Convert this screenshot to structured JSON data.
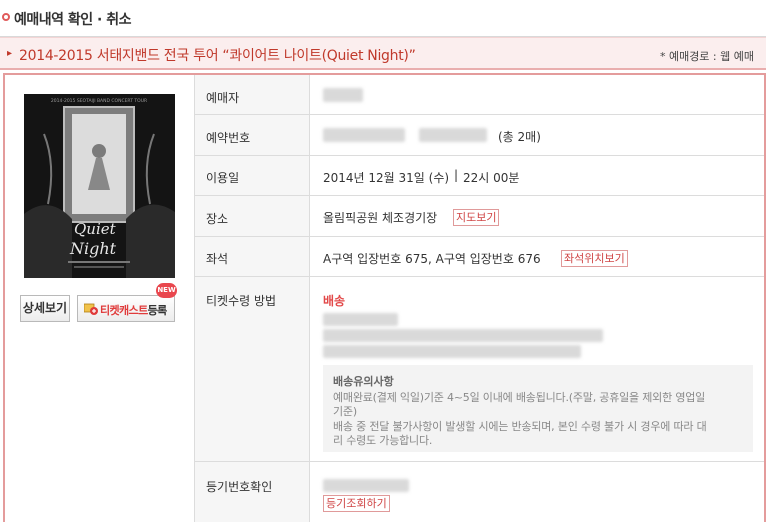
{
  "page": {
    "title": "예매내역 확인 · 취소"
  },
  "event": {
    "title": "2014-2015 서태지밴드 전국 투어 “콰이어트 나이트(Quiet Night)”",
    "route_label": "* 예매경로 : 웹 예매"
  },
  "poster": {
    "header_text": "2014-2015 SEOTAIJI BAND CONCERT TOUR",
    "logo_line1": "Quiet",
    "logo_line2": "Night"
  },
  "buttons": {
    "detail": "상세보기",
    "ticketcast_red": "티켓캐스트",
    "ticketcast_rest": "등록",
    "new_badge": "NEW"
  },
  "rows": {
    "booker_label": "예매자",
    "booking_no_label": "예약번호",
    "booking_count": "(총 2매)",
    "date_label": "이용일",
    "date_value": "2014년 12월 31일 (수)",
    "time_value": "22시 00분",
    "venue_label": "장소",
    "venue_value": "올림픽공원 체조경기장",
    "map_button": "지도보기",
    "seat_label": "좌석",
    "seat_value": "A구역 입장번호 675, A구역 입장번호 676",
    "seat_map_button": "좌석위치보기",
    "receive_label": "티켓수령 방법",
    "receive_value": "배송",
    "notice_title": "배송유의사항",
    "notice_line1": "예매완료(결제 익일)기준 4~5일 이내에 배송됩니다.(주말, 공휴일을 제외한 영업일",
    "notice_line2": "기준)",
    "notice_line3": "배송 중 전달 불가사항이 발생할 시에는 반송되며, 본인 수령 불가 시 경우에 따라 대",
    "notice_line4": "리 수령도 가능합니다.",
    "registered_label": "등기번호확인",
    "registered_button": "등기조회하기"
  },
  "colors": {
    "accent": "#c0392b",
    "panel_border": "#e49c9c",
    "event_bar_bg": "#fbeeee"
  }
}
